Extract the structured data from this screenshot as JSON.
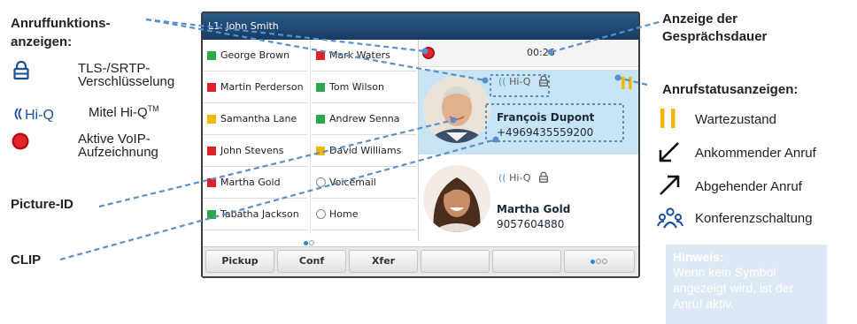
{
  "left_legend": {
    "title_line1": "Anruffunktions-",
    "title_line2": "anzeigen:",
    "tls_line1": "TLS-/SRTP-",
    "tls_line2": "Verschlüsselung",
    "hiq_icon_text": "Hi-Q",
    "hiq_label": "Mitel Hi-Q",
    "hiq_sup": "TM",
    "rec_line1": "Aktive VoIP-",
    "rec_line2": "Aufzeichnung",
    "picture_id_label": "Picture-ID",
    "clip_label": "CLIP"
  },
  "phone": {
    "header_title": "L1: John Smith",
    "call_duration": "00:26",
    "contacts_left": [
      {
        "name": "George Brown",
        "status": "green"
      },
      {
        "name": "Martin Perderson",
        "status": "red"
      },
      {
        "name": "Samantha Lane",
        "status": "yellow"
      },
      {
        "name": "John Stevens",
        "status": "red"
      },
      {
        "name": "Martha Gold",
        "status": "red"
      },
      {
        "name": "Tabatha Jackson",
        "status": "green"
      }
    ],
    "contacts_right": [
      {
        "name": "Mark Waters",
        "status": "red"
      },
      {
        "name": "Tom Wilson",
        "status": "green"
      },
      {
        "name": "Andrew Senna",
        "status": "green"
      },
      {
        "name": "David Williams",
        "status": "yellow"
      },
      {
        "name": "Voicemail",
        "status": "none"
      },
      {
        "name": "Home",
        "status": "none"
      }
    ],
    "active_call": {
      "name": "François Dupont",
      "number": "+4969435559200",
      "hiq": "Hi-Q"
    },
    "second_call": {
      "name": "Martha Gold",
      "number": "9057604880",
      "hiq": "Hi-Q"
    },
    "softkeys": [
      "Pickup",
      "Conf",
      "Xfer",
      "",
      ""
    ]
  },
  "right_legend": {
    "duration_title_line1": "Anzeige der",
    "duration_title_line2": "Gesprächsdauer",
    "status_title": "Anrufstatusanzeigen:",
    "hold_label": "Wartezustand",
    "incoming_label": "Ankommender Anruf",
    "outgoing_label": "Abgehender Anruf",
    "conference_label": "Konferenzschaltung",
    "note_title": "Hinweis:",
    "note_lines": [
      "Wenn kein Symbol",
      "angezeigt wird, ist der",
      "Anruf aktiv."
    ]
  },
  "colors": {
    "green": "#2aa84a",
    "red": "#d9252a",
    "yellow": "#f2b705",
    "accent_blue": "#1f73b7",
    "header_blue": "#1f4a74",
    "callout_blue": "#5b8fc9",
    "active_bg": "#c7e4f4"
  }
}
